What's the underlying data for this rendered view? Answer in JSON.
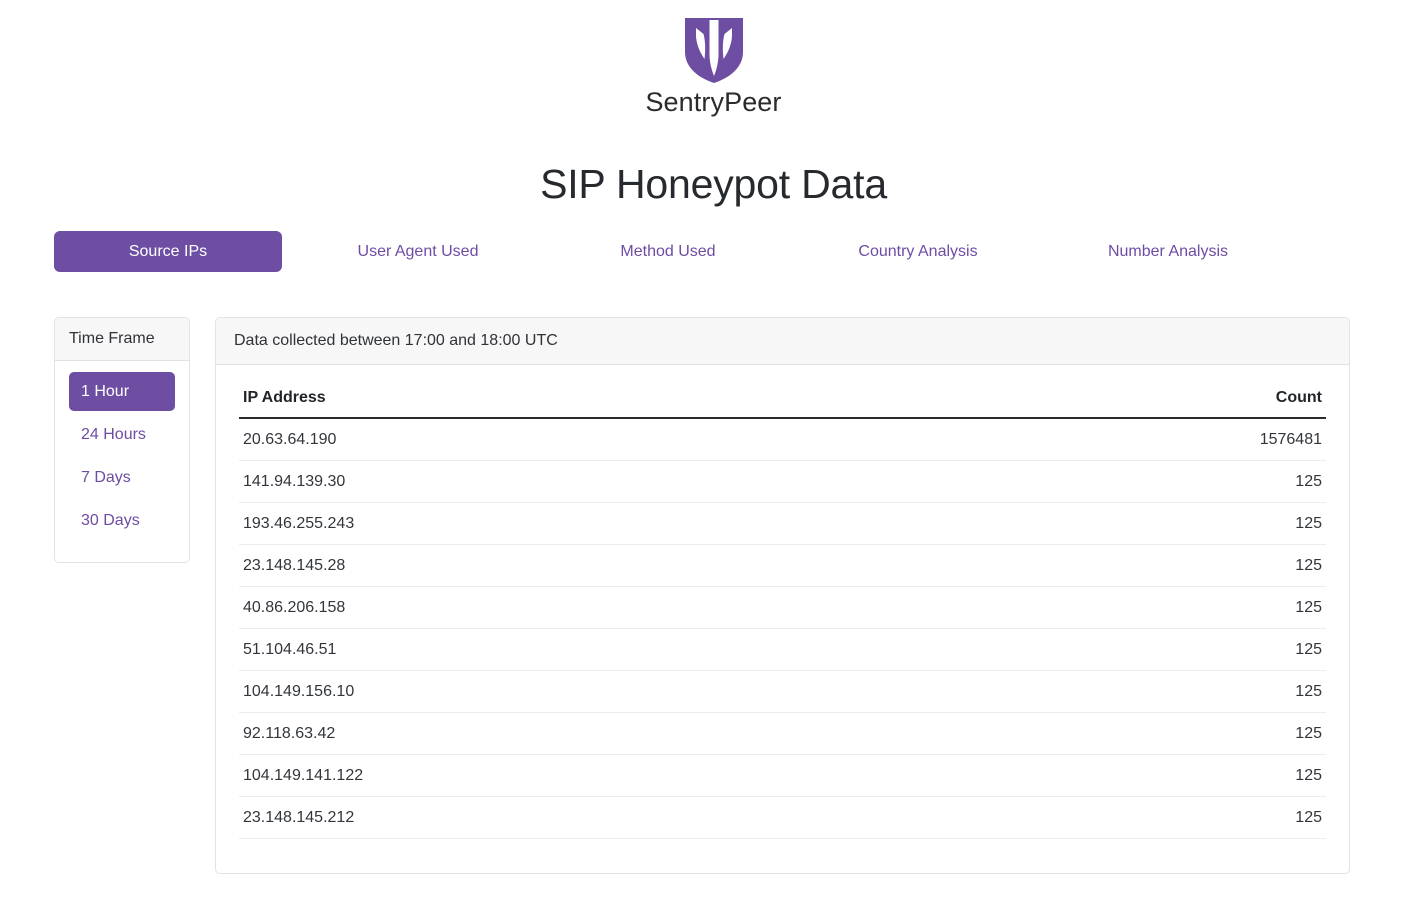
{
  "brand": {
    "logo_icon": "sentrypeer-shield-logo",
    "wordmark": "SentryPeer",
    "logo_color": "#6d4ea3"
  },
  "page": {
    "title": "SIP Honeypot Data",
    "accent_color": "#6d4ea3"
  },
  "tabs": [
    {
      "label": "Source IPs",
      "active": true
    },
    {
      "label": "User Agent Used",
      "active": false
    },
    {
      "label": "Method Used",
      "active": false
    },
    {
      "label": "Country Analysis",
      "active": false
    },
    {
      "label": "Number Analysis",
      "active": false
    }
  ],
  "sidebar": {
    "header": "Time Frame",
    "items": [
      {
        "label": "1 Hour",
        "active": true
      },
      {
        "label": "24 Hours",
        "active": false
      },
      {
        "label": "7 Days",
        "active": false
      },
      {
        "label": "30 Days",
        "active": false
      }
    ]
  },
  "card": {
    "header": "Data collected between 17:00 and 18:00 UTC",
    "columns": [
      "IP Address",
      "Count"
    ],
    "rows": [
      {
        "ip": "20.63.64.190",
        "count": "1576481"
      },
      {
        "ip": "141.94.139.30",
        "count": "125"
      },
      {
        "ip": "193.46.255.243",
        "count": "125"
      },
      {
        "ip": "23.148.145.28",
        "count": "125"
      },
      {
        "ip": "40.86.206.158",
        "count": "125"
      },
      {
        "ip": "51.104.46.51",
        "count": "125"
      },
      {
        "ip": "104.149.156.10",
        "count": "125"
      },
      {
        "ip": "92.118.63.42",
        "count": "125"
      },
      {
        "ip": "104.149.141.122",
        "count": "125"
      },
      {
        "ip": "23.148.145.212",
        "count": "125"
      }
    ]
  }
}
